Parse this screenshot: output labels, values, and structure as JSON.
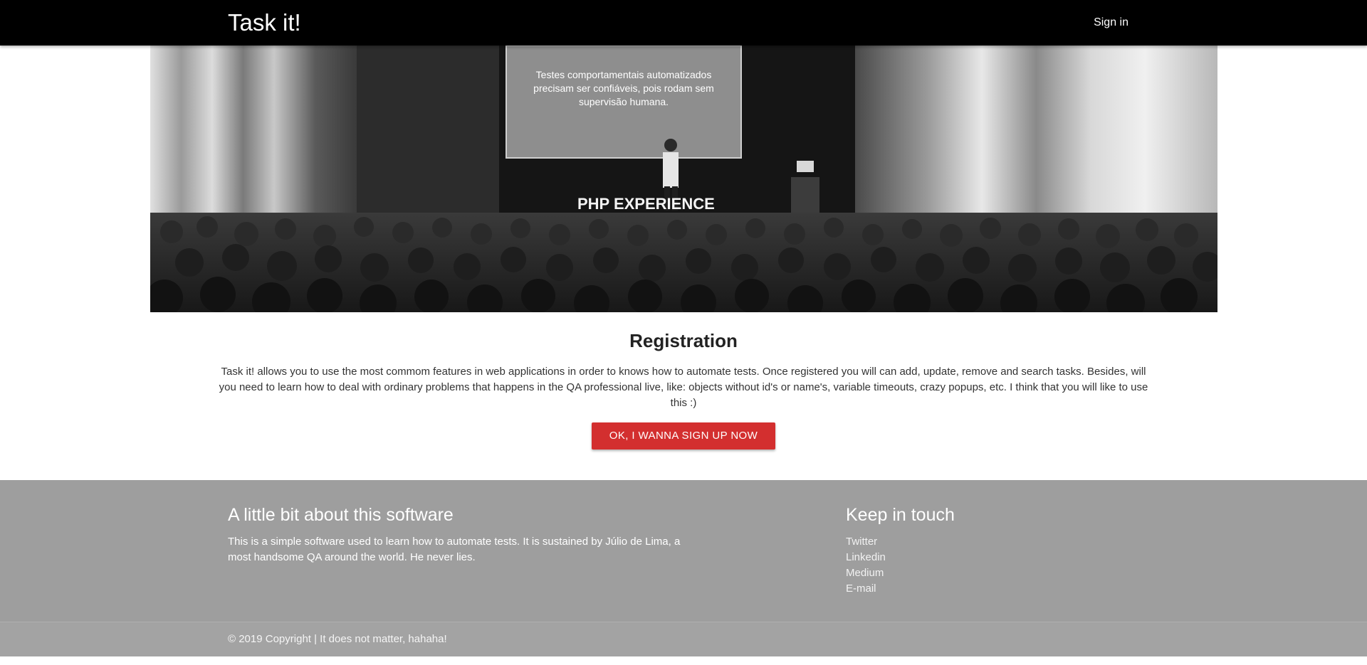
{
  "navbar": {
    "brand": "Task it!",
    "signin_label": "Sign in"
  },
  "hero": {
    "image_subject": "grayscale photo of a speaker on stage presenting to a large audience",
    "slide_text_lines": [
      "Testes comportamentais automatizados",
      "precisam ser confiáveis, pois rodam sem",
      "supervisão humana."
    ],
    "stage_sign": "PHP EXPERIENCE"
  },
  "registration": {
    "title": "Registration",
    "text": "Task it! allows you to use the most commom features in web applications in order to knows how to automate tests. Once registered you will can add, update, remove and search tasks. Besides, will you need to learn how to deal with ordinary problems that happens in the QA professional live, like: objects without id's or name's, variable timeouts, crazy popups, etc. I think that you will like to use this :)",
    "button_label": "OK, I WANNA SIGN UP NOW"
  },
  "footer": {
    "about_title": "A little bit about this software",
    "about_text": "This is a simple software used to learn how to automate tests. It is sustained by Júlio de Lima, a most handsome QA around the world. He never lies.",
    "contact_title": "Keep in touch",
    "links": [
      {
        "label": "Twitter"
      },
      {
        "label": "Linkedin"
      },
      {
        "label": "Medium"
      },
      {
        "label": "E-mail"
      }
    ],
    "copyright": "© 2019 Copyright | It does not matter, hahaha!"
  },
  "colors": {
    "navbar_bg": "#000000",
    "button_bg": "#d32f2f",
    "footer_bg": "#9e9e9e",
    "copyright_bg": "#a3a3a3"
  }
}
